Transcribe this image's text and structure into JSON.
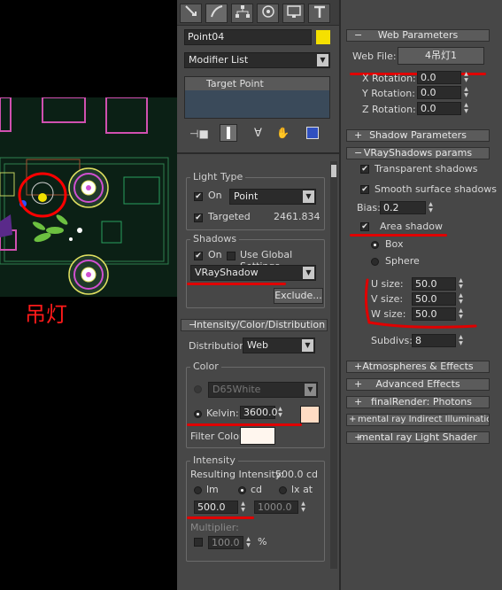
{
  "viewport": {
    "annotation": "吊灯"
  },
  "toolbar": {
    "tabs": [
      {
        "icon": "create-icon"
      },
      {
        "icon": "modify-icon"
      },
      {
        "icon": "hierarchy-icon"
      },
      {
        "icon": "motion-icon"
      },
      {
        "icon": "display-icon"
      },
      {
        "icon": "utilities-icon"
      }
    ]
  },
  "object": {
    "name": "Point04",
    "color": "#f5e000"
  },
  "modifier": {
    "list_label": "Modifier List",
    "stack_item": "Target Point"
  },
  "light_type": {
    "title": "Light Type",
    "on_label": "On",
    "type_value": "Point",
    "targeted_label": "Targeted",
    "target_distance": "2461.834"
  },
  "shadows": {
    "title": "Shadows",
    "on_label": "On",
    "global_label": "Use Global Settings",
    "type_value": "VRayShadow",
    "exclude_label": "Exclude..."
  },
  "intensity_rollout": {
    "title": "Intensity/Color/Distribution",
    "distribution_label": "Distribution:",
    "distribution_value": "Web",
    "color_title": "Color",
    "preset_value": "D65White",
    "kelvin_label": "Kelvin:",
    "kelvin_value": "3600.0",
    "kelvin_swatch": "#ffdcc4",
    "filter_label": "Filter Color:",
    "filter_swatch": "#fff6ee",
    "intensity_title": "Intensity",
    "resulting_label": "Resulting Intensity:",
    "resulting_value": "500.0 cd",
    "unit_lm": "lm",
    "unit_cd": "cd",
    "unit_lx": "lx at",
    "intensity_value": "500.0",
    "lx_distance": "1000.0",
    "multiplier_label": "Multiplier:",
    "multiplier_value": "100.0",
    "percent": "%"
  },
  "web_params": {
    "title": "Web Parameters",
    "web_file_label": "Web File:",
    "web_file_value": "4吊灯1",
    "x_label": "X Rotation:",
    "x_value": "0.0",
    "y_label": "Y Rotation:",
    "y_value": "0.0",
    "z_label": "Z Rotation:",
    "z_value": "0.0"
  },
  "shadow_params": {
    "title": "Shadow Parameters"
  },
  "vray_shadows": {
    "title": "VRayShadows params",
    "transparent_label": "Transparent shadows",
    "smooth_label": "Smooth surface shadows",
    "bias_label": "Bias:",
    "bias_value": "0.2",
    "area_label": "Area shadow",
    "box_label": "Box",
    "sphere_label": "Sphere",
    "u_label": "U size:",
    "u_value": "50.0",
    "v_label": "V size:",
    "v_value": "50.0",
    "w_label": "W size:",
    "w_value": "50.0",
    "subdivs_label": "Subdivs:",
    "subdivs_value": "8"
  },
  "collapsed_rollouts": [
    "Atmospheres & Effects",
    "Advanced Effects",
    "finalRender: Photons",
    "mental ray Indirect Illumination",
    "mental ray Light Shader"
  ]
}
